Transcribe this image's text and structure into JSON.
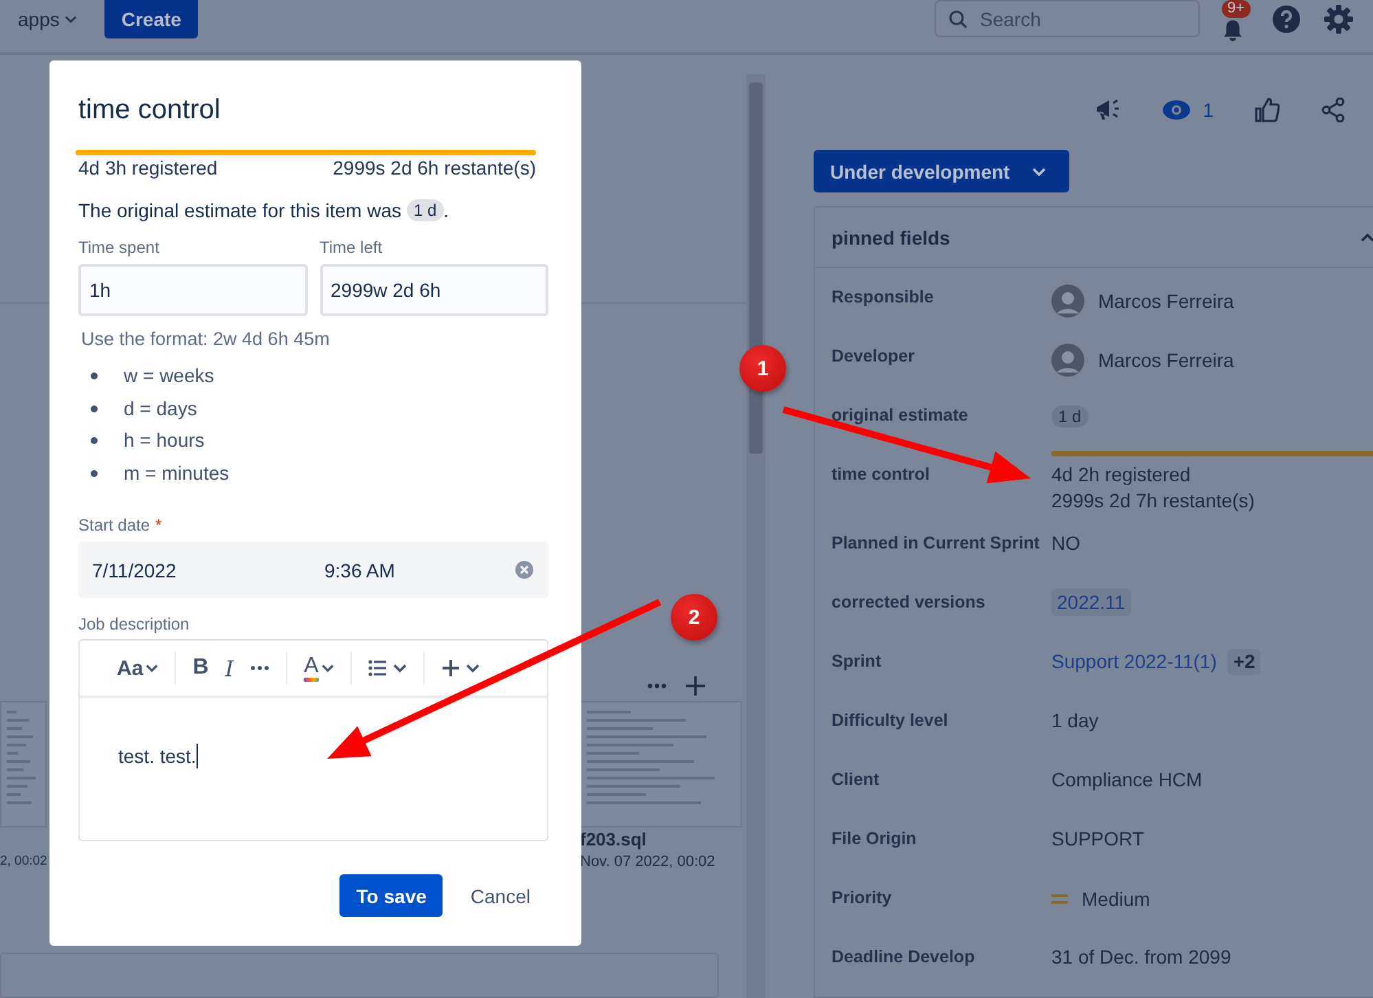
{
  "topbar": {
    "apps_menu": "apps",
    "create_button": "Create",
    "search": {
      "placeholder": "Search"
    },
    "notifications_badge": "9+"
  },
  "attachments": [
    {
      "date": "2, 00:02"
    },
    {
      "name": "f203.sql",
      "date": "Nov. 07 2022, 00:02"
    }
  ],
  "watchers_count": "1",
  "status_button": "Under development",
  "pinned_fields": {
    "title": "pinned fields",
    "expanded": true,
    "fields": [
      {
        "label": "Responsible",
        "kind": "person",
        "value": "Marcos Ferreira"
      },
      {
        "label": "Developer",
        "kind": "person",
        "value": "Marcos Ferreira"
      },
      {
        "label": "original estimate",
        "kind": "tag",
        "value": "1 d"
      },
      {
        "label": "time control",
        "kind": "time",
        "level": 1,
        "registered": "4d 2h registered",
        "remaining": "2999s 2d 7h restante(s)"
      },
      {
        "label": "Planned in Current Sprint",
        "kind": "text",
        "value": "NO"
      },
      {
        "label": "corrected versions",
        "kind": "version",
        "value": "2022.11"
      },
      {
        "label": "Sprint",
        "kind": "sprint",
        "value": "Support 2022-11(1)",
        "extra": "+2"
      },
      {
        "label": "Difficulty level",
        "kind": "text",
        "value": "1 day"
      },
      {
        "label": "Client",
        "kind": "text",
        "value": "Compliance HCM"
      },
      {
        "label": "File Origin",
        "kind": "text",
        "value": "SUPPORT"
      },
      {
        "label": "Priority",
        "kind": "priority",
        "value": "Medium"
      },
      {
        "label": "Deadline Develop",
        "kind": "text",
        "value": "31 of Dec. from 2099"
      }
    ]
  },
  "modal": {
    "title": "time control",
    "progress": {
      "level": 1,
      "registered": "4d 3h registered",
      "remaining": "2999s 2d 6h restante(s)"
    },
    "estimate_note": {
      "text": "The original estimate for this item was",
      "tag": "1 d",
      "end": "."
    },
    "fields": [
      {
        "label": "Time spent",
        "value": "1h"
      },
      {
        "label": "Time left",
        "value": "2999w 2d 6h"
      }
    ],
    "format_hint": "Use the format: 2w 4d 6h 45m",
    "format_units": [
      "w = weeks",
      "d = days",
      "h = hours",
      "m = minutes"
    ],
    "start_date": {
      "label": "Start date",
      "required": true,
      "required_marker": "*",
      "date": "7/11/2022",
      "time": "9:36 AM"
    },
    "description": {
      "label": "Job description",
      "toolbar": [
        {
          "kind": "text-style",
          "label": "Aa"
        },
        {
          "kind": "bold",
          "label": "B"
        },
        {
          "kind": "italic",
          "label": "I"
        },
        {
          "kind": "more"
        },
        {
          "kind": "color",
          "label": "A"
        },
        {
          "kind": "list"
        },
        {
          "kind": "insert"
        }
      ],
      "text": "test. test."
    },
    "buttons": [
      {
        "kind": "primary",
        "label": "To save"
      },
      {
        "kind": "subtle",
        "label": "Cancel"
      }
    ]
  },
  "annotations": [
    {
      "label": "1"
    },
    {
      "label": "2"
    }
  ]
}
